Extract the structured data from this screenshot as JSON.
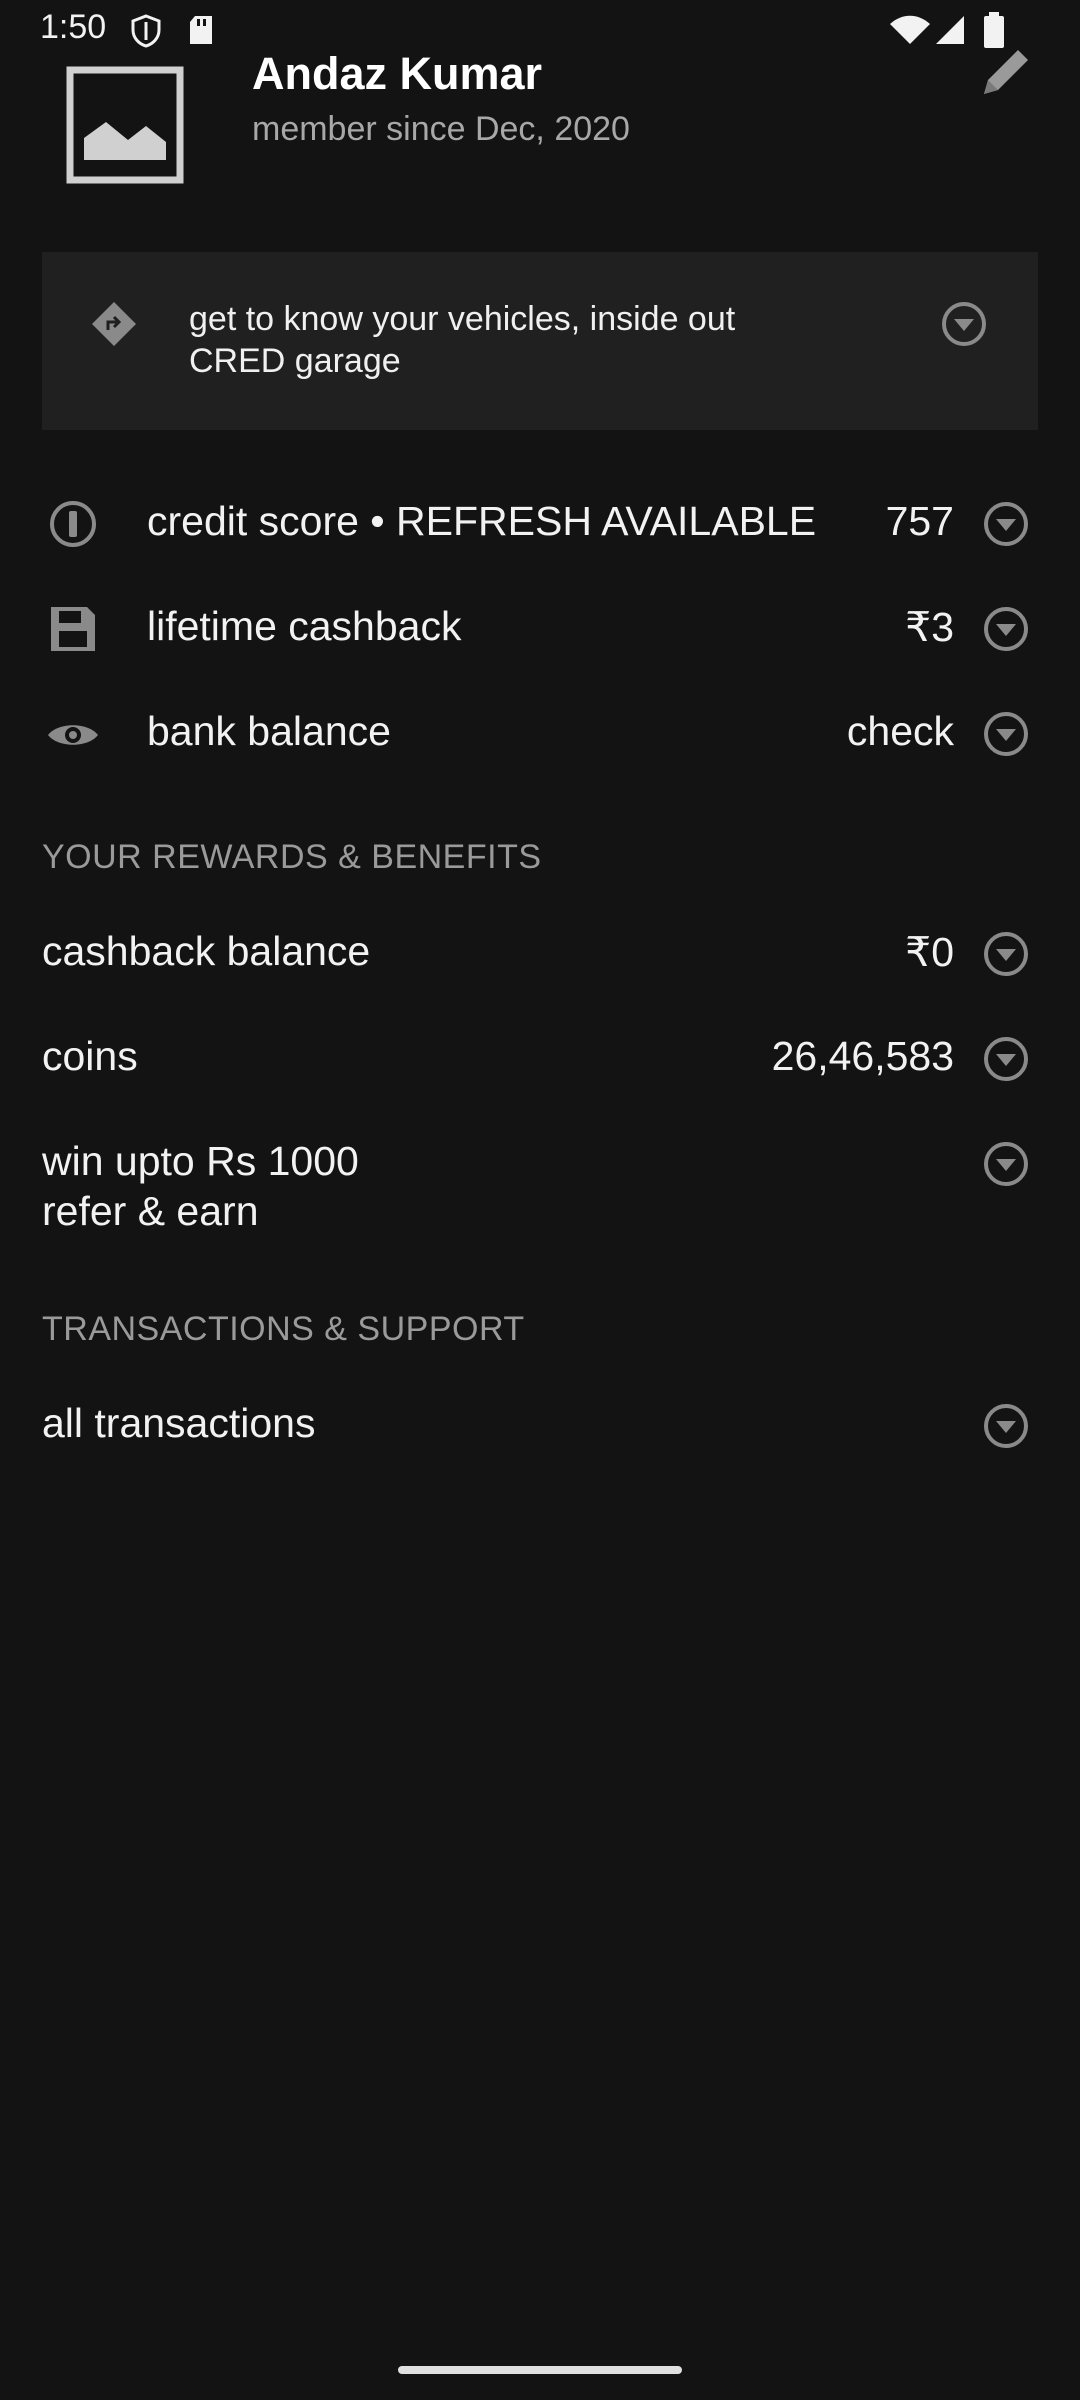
{
  "status_bar": {
    "time": "1:50"
  },
  "profile": {
    "name": "Andaz Kumar",
    "member_since": "member since Dec, 2020"
  },
  "promo": {
    "line1": "get to know your vehicles, inside out",
    "line2": "CRED garage"
  },
  "account_rows": [
    {
      "label": "credit score • REFRESH AVAILABLE",
      "value": "757",
      "icon": "info-circle-icon"
    },
    {
      "label": "lifetime cashback",
      "value": "₹3",
      "icon": "floppy-disk-icon"
    },
    {
      "label": "bank balance",
      "value": "check",
      "icon": "eye-icon"
    }
  ],
  "rewards": {
    "title": "YOUR REWARDS & BENEFITS",
    "rows": [
      {
        "label": "cashback balance",
        "value": "₹0"
      },
      {
        "label": "coins",
        "value": "26,46,583"
      },
      {
        "label": "win upto Rs 1000",
        "sublabel": "refer & earn",
        "value": ""
      }
    ]
  },
  "support": {
    "title": "TRANSACTIONS & SUPPORT",
    "rows": [
      {
        "label": "all transactions",
        "value": ""
      }
    ]
  },
  "colors": {
    "background": "#131313",
    "card": "#202020",
    "icon_grey": "#8a8a8a",
    "text": "#f2f2f2",
    "muted": "#9a9a9a"
  }
}
